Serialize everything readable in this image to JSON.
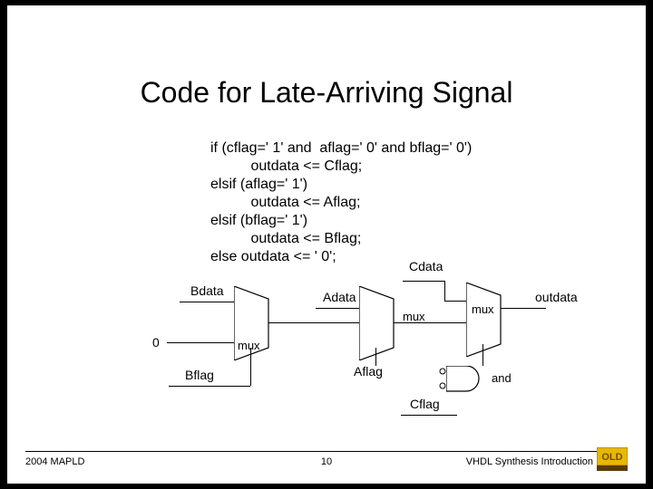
{
  "title": "Code for Late-Arriving Signal",
  "code": {
    "l1": "if (cflag=' 1' and  aflag=' 0' and bflag=' 0')",
    "l2": "          outdata <= Cflag;",
    "l3": "elsif (aflag=' 1')",
    "l4": "          outdata <= Aflag;",
    "l5": "elsif (bflag=' 1')",
    "l6": "          outdata <= Bflag;",
    "l7": "else outdata <= ' 0';"
  },
  "diagram": {
    "cdata": "Cdata",
    "bdata": "Bdata",
    "adata": "Adata",
    "zero": "0",
    "bflag": "Bflag",
    "aflag": "Aflag",
    "cflag": "Cflag",
    "mux": "mux",
    "and": "and",
    "outdata": "outdata"
  },
  "footer": {
    "left": "2004 MAPLD",
    "center": "10",
    "right": "VHDL Synthesis Introduction"
  }
}
